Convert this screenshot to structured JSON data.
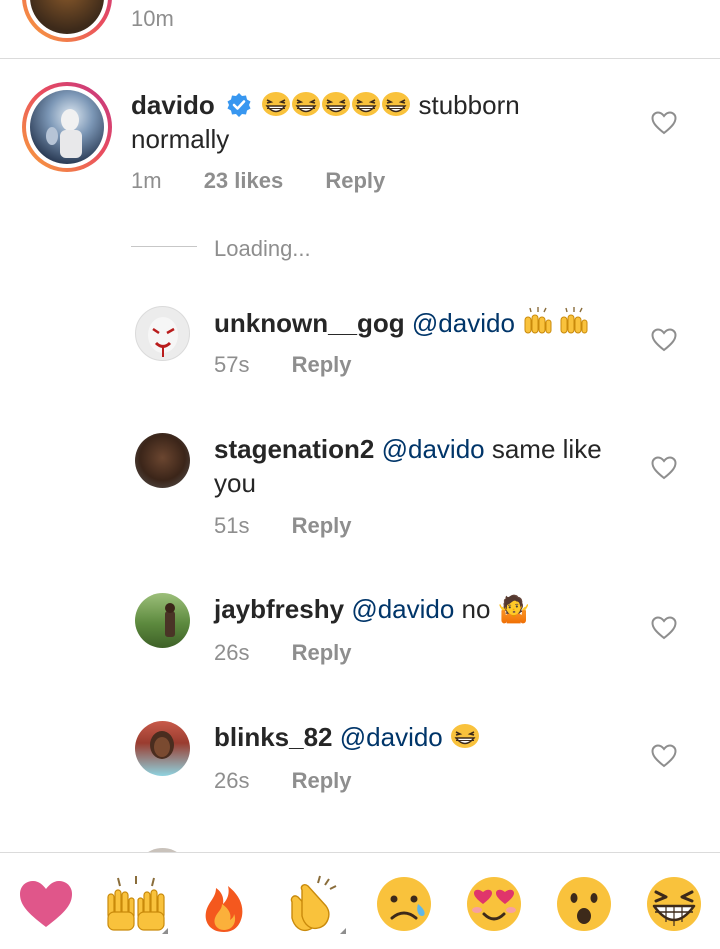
{
  "top_comment": {
    "time": "10m"
  },
  "main_comment": {
    "username": "davido",
    "text_suffix": "stubborn normally",
    "time": "1m",
    "likes": "23 likes",
    "reply": "Reply",
    "emoji_count": 5
  },
  "loading_text": "Loading...",
  "replies": [
    {
      "username": "unknown__gog",
      "mention": "@davido",
      "text": "",
      "emoji": "raising-hands-x2",
      "time": "57s",
      "reply": "Reply"
    },
    {
      "username": "stagenation2",
      "mention": "@davido",
      "text": " same like you",
      "time": "51s",
      "reply": "Reply"
    },
    {
      "username": "jaybfreshy",
      "mention": "@davido",
      "text": " no 🤷",
      "time": "26s",
      "reply": "Reply"
    },
    {
      "username": "blinks_82",
      "mention": "@davido",
      "text": "",
      "emoji": "grinning-squinting",
      "time": "26s",
      "reply": "Reply"
    }
  ],
  "emoji_tray": [
    "red-heart",
    "raising-hands",
    "fire",
    "clapping-hands",
    "crying-face",
    "heart-eyes",
    "astonished-face",
    "grinning-squinting-face"
  ],
  "colors": {
    "accent_blue": "#003569",
    "meta_gray": "#8e8e8e",
    "verified": "#3897f0",
    "heart_pink": "#e0568a"
  }
}
